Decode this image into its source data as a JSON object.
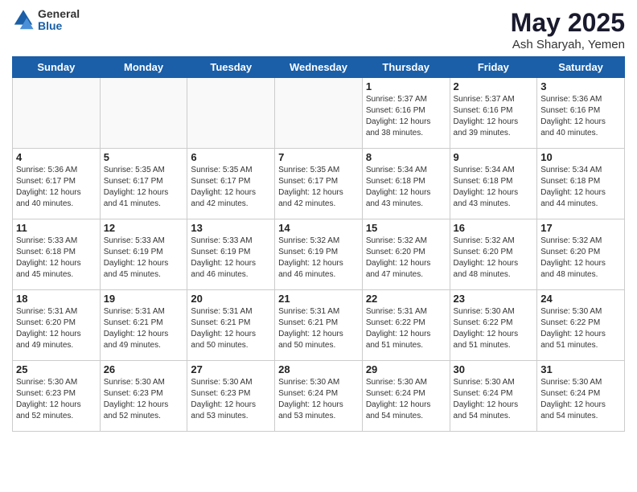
{
  "header": {
    "logo_general": "General",
    "logo_blue": "Blue",
    "month_year": "May 2025",
    "location": "Ash Sharyah, Yemen"
  },
  "days_of_week": [
    "Sunday",
    "Monday",
    "Tuesday",
    "Wednesday",
    "Thursday",
    "Friday",
    "Saturday"
  ],
  "weeks": [
    [
      {
        "day": "",
        "text": ""
      },
      {
        "day": "",
        "text": ""
      },
      {
        "day": "",
        "text": ""
      },
      {
        "day": "",
        "text": ""
      },
      {
        "day": "1",
        "text": "Sunrise: 5:37 AM\nSunset: 6:16 PM\nDaylight: 12 hours\nand 38 minutes."
      },
      {
        "day": "2",
        "text": "Sunrise: 5:37 AM\nSunset: 6:16 PM\nDaylight: 12 hours\nand 39 minutes."
      },
      {
        "day": "3",
        "text": "Sunrise: 5:36 AM\nSunset: 6:16 PM\nDaylight: 12 hours\nand 40 minutes."
      }
    ],
    [
      {
        "day": "4",
        "text": "Sunrise: 5:36 AM\nSunset: 6:17 PM\nDaylight: 12 hours\nand 40 minutes."
      },
      {
        "day": "5",
        "text": "Sunrise: 5:35 AM\nSunset: 6:17 PM\nDaylight: 12 hours\nand 41 minutes."
      },
      {
        "day": "6",
        "text": "Sunrise: 5:35 AM\nSunset: 6:17 PM\nDaylight: 12 hours\nand 42 minutes."
      },
      {
        "day": "7",
        "text": "Sunrise: 5:35 AM\nSunset: 6:17 PM\nDaylight: 12 hours\nand 42 minutes."
      },
      {
        "day": "8",
        "text": "Sunrise: 5:34 AM\nSunset: 6:18 PM\nDaylight: 12 hours\nand 43 minutes."
      },
      {
        "day": "9",
        "text": "Sunrise: 5:34 AM\nSunset: 6:18 PM\nDaylight: 12 hours\nand 43 minutes."
      },
      {
        "day": "10",
        "text": "Sunrise: 5:34 AM\nSunset: 6:18 PM\nDaylight: 12 hours\nand 44 minutes."
      }
    ],
    [
      {
        "day": "11",
        "text": "Sunrise: 5:33 AM\nSunset: 6:18 PM\nDaylight: 12 hours\nand 45 minutes."
      },
      {
        "day": "12",
        "text": "Sunrise: 5:33 AM\nSunset: 6:19 PM\nDaylight: 12 hours\nand 45 minutes."
      },
      {
        "day": "13",
        "text": "Sunrise: 5:33 AM\nSunset: 6:19 PM\nDaylight: 12 hours\nand 46 minutes."
      },
      {
        "day": "14",
        "text": "Sunrise: 5:32 AM\nSunset: 6:19 PM\nDaylight: 12 hours\nand 46 minutes."
      },
      {
        "day": "15",
        "text": "Sunrise: 5:32 AM\nSunset: 6:20 PM\nDaylight: 12 hours\nand 47 minutes."
      },
      {
        "day": "16",
        "text": "Sunrise: 5:32 AM\nSunset: 6:20 PM\nDaylight: 12 hours\nand 48 minutes."
      },
      {
        "day": "17",
        "text": "Sunrise: 5:32 AM\nSunset: 6:20 PM\nDaylight: 12 hours\nand 48 minutes."
      }
    ],
    [
      {
        "day": "18",
        "text": "Sunrise: 5:31 AM\nSunset: 6:20 PM\nDaylight: 12 hours\nand 49 minutes."
      },
      {
        "day": "19",
        "text": "Sunrise: 5:31 AM\nSunset: 6:21 PM\nDaylight: 12 hours\nand 49 minutes."
      },
      {
        "day": "20",
        "text": "Sunrise: 5:31 AM\nSunset: 6:21 PM\nDaylight: 12 hours\nand 50 minutes."
      },
      {
        "day": "21",
        "text": "Sunrise: 5:31 AM\nSunset: 6:21 PM\nDaylight: 12 hours\nand 50 minutes."
      },
      {
        "day": "22",
        "text": "Sunrise: 5:31 AM\nSunset: 6:22 PM\nDaylight: 12 hours\nand 51 minutes."
      },
      {
        "day": "23",
        "text": "Sunrise: 5:30 AM\nSunset: 6:22 PM\nDaylight: 12 hours\nand 51 minutes."
      },
      {
        "day": "24",
        "text": "Sunrise: 5:30 AM\nSunset: 6:22 PM\nDaylight: 12 hours\nand 51 minutes."
      }
    ],
    [
      {
        "day": "25",
        "text": "Sunrise: 5:30 AM\nSunset: 6:23 PM\nDaylight: 12 hours\nand 52 minutes."
      },
      {
        "day": "26",
        "text": "Sunrise: 5:30 AM\nSunset: 6:23 PM\nDaylight: 12 hours\nand 52 minutes."
      },
      {
        "day": "27",
        "text": "Sunrise: 5:30 AM\nSunset: 6:23 PM\nDaylight: 12 hours\nand 53 minutes."
      },
      {
        "day": "28",
        "text": "Sunrise: 5:30 AM\nSunset: 6:24 PM\nDaylight: 12 hours\nand 53 minutes."
      },
      {
        "day": "29",
        "text": "Sunrise: 5:30 AM\nSunset: 6:24 PM\nDaylight: 12 hours\nand 54 minutes."
      },
      {
        "day": "30",
        "text": "Sunrise: 5:30 AM\nSunset: 6:24 PM\nDaylight: 12 hours\nand 54 minutes."
      },
      {
        "day": "31",
        "text": "Sunrise: 5:30 AM\nSunset: 6:24 PM\nDaylight: 12 hours\nand 54 minutes."
      }
    ]
  ]
}
